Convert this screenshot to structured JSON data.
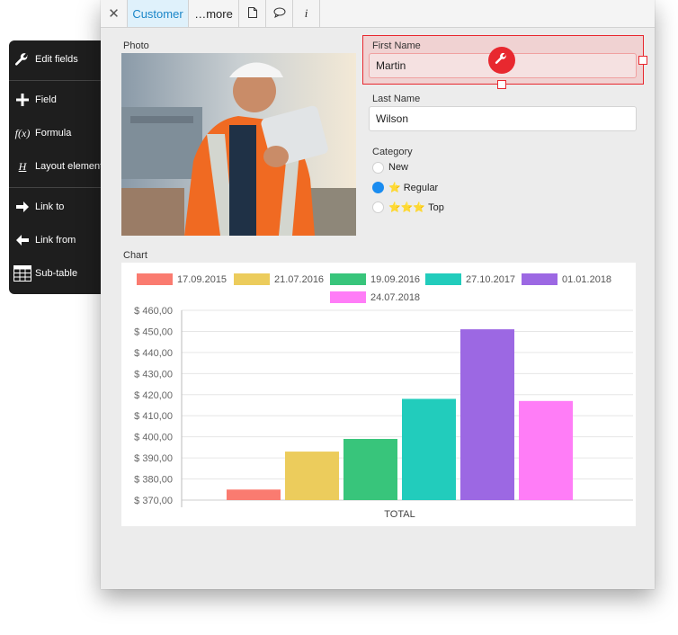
{
  "tabs": {
    "close": "✕",
    "customer": "Customer",
    "more": "…more",
    "doc_icon": "document-icon",
    "comment_icon": "speech-bubble-icon",
    "info": "i"
  },
  "form": {
    "photo_label": "Photo",
    "first_name_label": "First Name",
    "first_name_value": "Martin",
    "last_name_label": "Last Name",
    "last_name_value": "Wilson",
    "category_label": "Category",
    "category_options": [
      {
        "label": "New",
        "stars": "",
        "selected": false
      },
      {
        "label": "Regular",
        "stars": "⭐",
        "selected": true
      },
      {
        "label": "Top",
        "stars": "⭐⭐⭐",
        "selected": false
      }
    ],
    "chart_label": "Chart"
  },
  "chart_data": {
    "type": "bar",
    "categories": [
      "TOTAL"
    ],
    "series": [
      {
        "name": "17.09.2015",
        "values": [
          375
        ],
        "color": "#fa7b70"
      },
      {
        "name": "21.07.2016",
        "values": [
          393
        ],
        "color": "#eccc5c"
      },
      {
        "name": "19.09.2016",
        "values": [
          399
        ],
        "color": "#38c57b"
      },
      {
        "name": "27.10.2017",
        "values": [
          418
        ],
        "color": "#22ccbc"
      },
      {
        "name": "01.01.2018",
        "values": [
          451
        ],
        "color": "#9c68e3"
      },
      {
        "name": "24.07.2018",
        "values": [
          417
        ],
        "color": "#ff7df7"
      }
    ],
    "ylim": [
      370,
      460
    ],
    "yticks": [
      "$ 370,00",
      "$ 380,00",
      "$ 390,00",
      "$ 400,00",
      "$ 410,00",
      "$ 420,00",
      "$ 430,00",
      "$ 440,00",
      "$ 450,00",
      "$ 460,00"
    ],
    "xlabel": "TOTAL",
    "grid": true,
    "legend": "top"
  },
  "palette": {
    "edit_fields": "Edit fields",
    "field": "Field",
    "formula_symbol": "f(x)",
    "formula": "Formula",
    "layout_symbol": "H",
    "layout_element": "Layout element",
    "link_to": "Link to",
    "link_from": "Link from",
    "sub_table": "Sub-table"
  },
  "colors": {
    "selection": "#e8282f",
    "accent": "#1a86c8",
    "radio_selected": "#1a8cf0"
  }
}
